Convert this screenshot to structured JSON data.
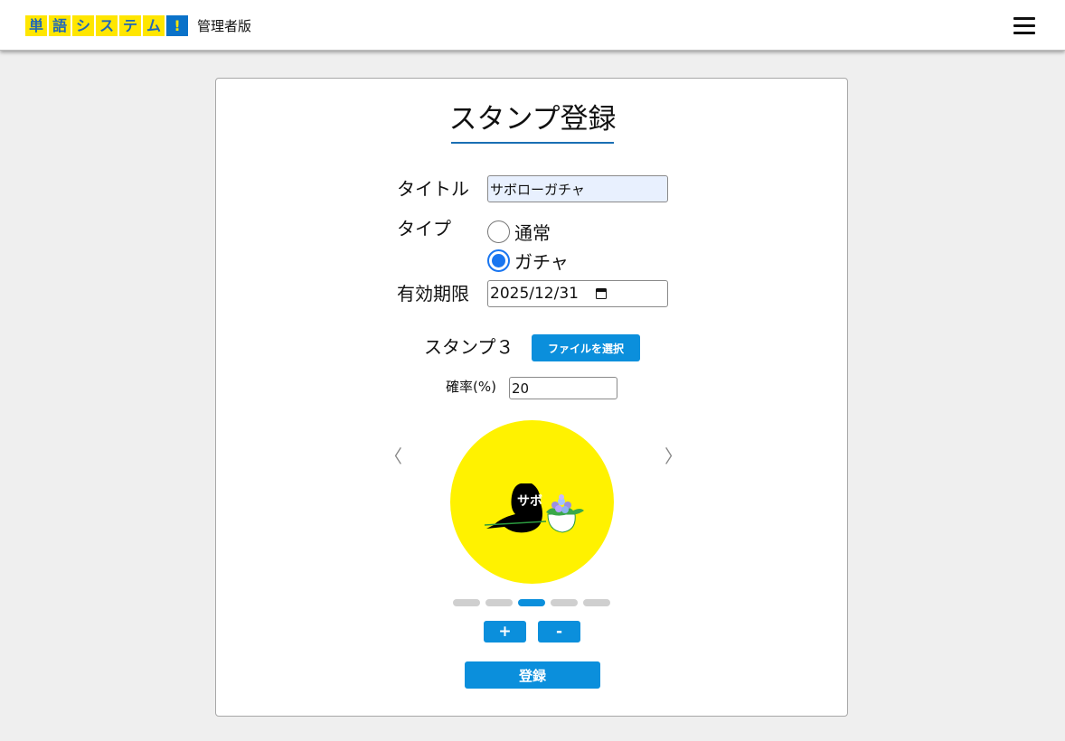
{
  "header": {
    "logo_chars": [
      "単",
      "語",
      "シ",
      "ス",
      "テ",
      "ム",
      "!"
    ],
    "edition": "管理者版",
    "menu_icon": "hamburger-menu-icon"
  },
  "form": {
    "heading": "スタンプ登録",
    "title_label": "タイトル",
    "title_value": "サボローガチャ",
    "type_label": "タイプ",
    "type_options": [
      {
        "label": "通常",
        "checked": false
      },
      {
        "label": "ガチャ",
        "checked": true
      }
    ],
    "expiry_label": "有効期限",
    "expiry_value": "2025/12/31",
    "stamp_label": "スタンプ３",
    "file_button": "ファイルを選択",
    "rate_label": "確率(%)",
    "rate_value": "20",
    "prev_arrow": "〈",
    "next_arrow": "〉",
    "stamp_text": "サボ",
    "carousel": {
      "count": 5,
      "active_index": 2
    },
    "plus_button": "+",
    "minus_button": "-",
    "submit_button": "登録"
  },
  "colors": {
    "accent": "#0b8fdc",
    "logo_yellow": "#ffe600",
    "logo_blue": "#0a72c9",
    "stamp_bg": "#fff200",
    "radio_checked": "#1976f0"
  }
}
